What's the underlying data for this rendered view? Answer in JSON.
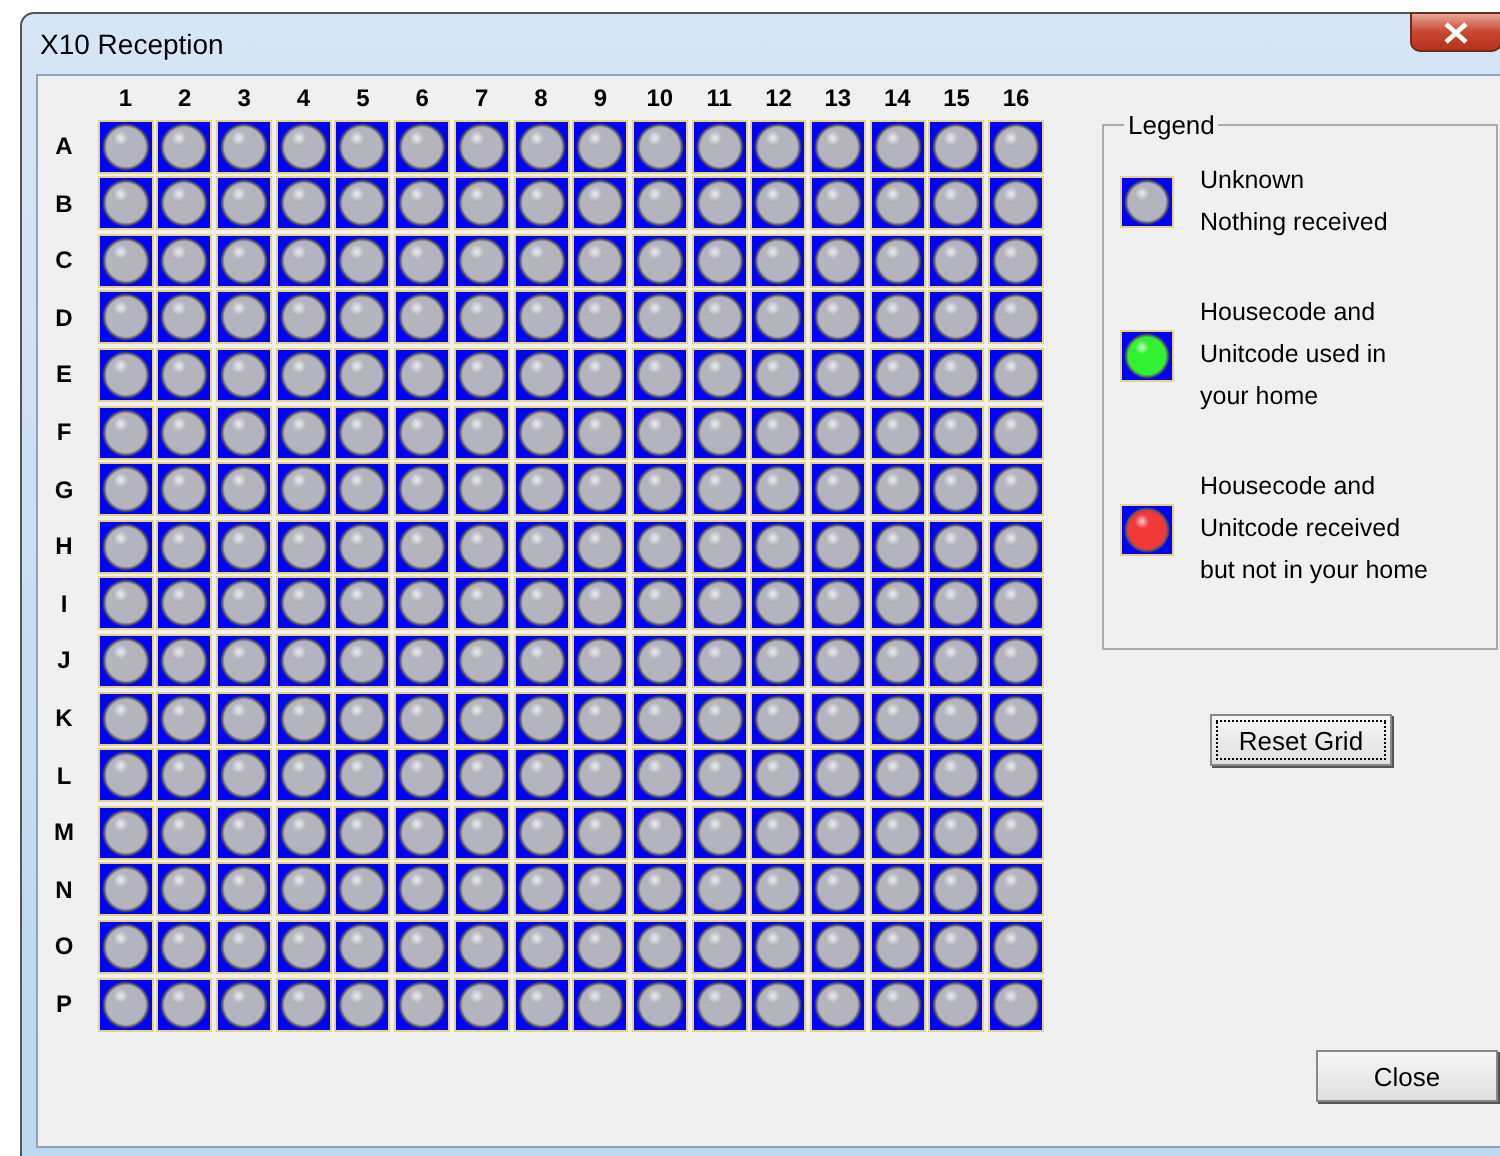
{
  "window": {
    "title": "X10 Reception"
  },
  "grid": {
    "columns": [
      "1",
      "2",
      "3",
      "4",
      "5",
      "6",
      "7",
      "8",
      "9",
      "10",
      "11",
      "12",
      "13",
      "14",
      "15",
      "16"
    ],
    "rows": [
      {
        "label": "A",
        "cells": [
          {
            "kind": "unknown"
          },
          {
            "kind": "unknown"
          },
          {
            "kind": "unknown"
          },
          {
            "kind": "unknown"
          },
          {
            "kind": "unknown"
          },
          {
            "kind": "unknown"
          },
          {
            "kind": "unknown"
          },
          {
            "kind": "unknown"
          },
          {
            "kind": "unknown"
          },
          {
            "kind": "unknown"
          },
          {
            "kind": "unknown"
          },
          {
            "kind": "unknown"
          },
          {
            "kind": "unknown"
          },
          {
            "kind": "unknown"
          },
          {
            "kind": "unknown"
          },
          {
            "kind": "unknown"
          }
        ]
      },
      {
        "label": "B",
        "cells": [
          {
            "kind": "unknown"
          },
          {
            "kind": "unknown"
          },
          {
            "kind": "unknown"
          },
          {
            "kind": "unknown"
          },
          {
            "kind": "unknown"
          },
          {
            "kind": "unknown"
          },
          {
            "kind": "unknown"
          },
          {
            "kind": "unknown"
          },
          {
            "kind": "unknown"
          },
          {
            "kind": "unknown"
          },
          {
            "kind": "unknown"
          },
          {
            "kind": "unknown"
          },
          {
            "kind": "unknown"
          },
          {
            "kind": "unknown"
          },
          {
            "kind": "unknown"
          },
          {
            "kind": "unknown"
          }
        ]
      },
      {
        "label": "C",
        "cells": [
          {
            "kind": "unknown"
          },
          {
            "kind": "unknown"
          },
          {
            "kind": "unknown"
          },
          {
            "kind": "unknown"
          },
          {
            "kind": "unknown"
          },
          {
            "kind": "unknown"
          },
          {
            "kind": "unknown"
          },
          {
            "kind": "unknown"
          },
          {
            "kind": "unknown"
          },
          {
            "kind": "unknown"
          },
          {
            "kind": "unknown"
          },
          {
            "kind": "unknown"
          },
          {
            "kind": "unknown"
          },
          {
            "kind": "unknown"
          },
          {
            "kind": "unknown"
          },
          {
            "kind": "unknown"
          }
        ]
      },
      {
        "label": "D",
        "cells": [
          {
            "kind": "unknown"
          },
          {
            "kind": "unknown"
          },
          {
            "kind": "unknown"
          },
          {
            "kind": "unknown"
          },
          {
            "kind": "unknown"
          },
          {
            "kind": "unknown"
          },
          {
            "kind": "unknown"
          },
          {
            "kind": "unknown"
          },
          {
            "kind": "unknown"
          },
          {
            "kind": "unknown"
          },
          {
            "kind": "unknown"
          },
          {
            "kind": "unknown"
          },
          {
            "kind": "unknown"
          },
          {
            "kind": "unknown"
          },
          {
            "kind": "unknown"
          },
          {
            "kind": "unknown"
          }
        ]
      },
      {
        "label": "E",
        "cells": [
          {
            "kind": "unknown"
          },
          {
            "kind": "unknown"
          },
          {
            "kind": "unknown"
          },
          {
            "kind": "unknown"
          },
          {
            "kind": "unknown"
          },
          {
            "kind": "unknown"
          },
          {
            "kind": "unknown"
          },
          {
            "kind": "unknown"
          },
          {
            "kind": "unknown"
          },
          {
            "kind": "unknown"
          },
          {
            "kind": "unknown"
          },
          {
            "kind": "unknown"
          },
          {
            "kind": "unknown"
          },
          {
            "kind": "unknown"
          },
          {
            "kind": "unknown"
          },
          {
            "kind": "unknown"
          }
        ]
      },
      {
        "label": "F",
        "cells": [
          {
            "kind": "unknown"
          },
          {
            "kind": "unknown"
          },
          {
            "kind": "unknown"
          },
          {
            "kind": "unknown"
          },
          {
            "kind": "unknown"
          },
          {
            "kind": "unknown"
          },
          {
            "kind": "unknown"
          },
          {
            "kind": "unknown"
          },
          {
            "kind": "unknown"
          },
          {
            "kind": "unknown"
          },
          {
            "kind": "unknown"
          },
          {
            "kind": "unknown"
          },
          {
            "kind": "unknown"
          },
          {
            "kind": "unknown"
          },
          {
            "kind": "unknown"
          },
          {
            "kind": "unknown"
          }
        ]
      },
      {
        "label": "G",
        "cells": [
          {
            "kind": "unknown"
          },
          {
            "kind": "unknown"
          },
          {
            "kind": "unknown"
          },
          {
            "kind": "unknown"
          },
          {
            "kind": "unknown"
          },
          {
            "kind": "unknown"
          },
          {
            "kind": "unknown"
          },
          {
            "kind": "unknown"
          },
          {
            "kind": "unknown"
          },
          {
            "kind": "unknown"
          },
          {
            "kind": "unknown"
          },
          {
            "kind": "unknown"
          },
          {
            "kind": "unknown"
          },
          {
            "kind": "unknown"
          },
          {
            "kind": "unknown"
          },
          {
            "kind": "unknown"
          }
        ]
      },
      {
        "label": "H",
        "cells": [
          {
            "kind": "unknown"
          },
          {
            "kind": "unknown"
          },
          {
            "kind": "unknown"
          },
          {
            "kind": "unknown"
          },
          {
            "kind": "unknown"
          },
          {
            "kind": "unknown"
          },
          {
            "kind": "unknown"
          },
          {
            "kind": "unknown"
          },
          {
            "kind": "unknown"
          },
          {
            "kind": "unknown"
          },
          {
            "kind": "unknown"
          },
          {
            "kind": "unknown"
          },
          {
            "kind": "unknown"
          },
          {
            "kind": "unknown"
          },
          {
            "kind": "unknown"
          },
          {
            "kind": "unknown"
          }
        ]
      },
      {
        "label": "I",
        "cells": [
          {
            "kind": "unknown"
          },
          {
            "kind": "unknown"
          },
          {
            "kind": "unknown"
          },
          {
            "kind": "unknown"
          },
          {
            "kind": "unknown"
          },
          {
            "kind": "unknown"
          },
          {
            "kind": "unknown"
          },
          {
            "kind": "unknown"
          },
          {
            "kind": "unknown"
          },
          {
            "kind": "unknown"
          },
          {
            "kind": "unknown"
          },
          {
            "kind": "unknown"
          },
          {
            "kind": "unknown"
          },
          {
            "kind": "unknown"
          },
          {
            "kind": "unknown"
          },
          {
            "kind": "unknown"
          }
        ]
      },
      {
        "label": "J",
        "cells": [
          {
            "kind": "unknown"
          },
          {
            "kind": "unknown"
          },
          {
            "kind": "unknown"
          },
          {
            "kind": "unknown"
          },
          {
            "kind": "unknown"
          },
          {
            "kind": "unknown"
          },
          {
            "kind": "unknown"
          },
          {
            "kind": "unknown"
          },
          {
            "kind": "unknown"
          },
          {
            "kind": "unknown"
          },
          {
            "kind": "unknown"
          },
          {
            "kind": "unknown"
          },
          {
            "kind": "unknown"
          },
          {
            "kind": "unknown"
          },
          {
            "kind": "unknown"
          },
          {
            "kind": "unknown"
          }
        ]
      },
      {
        "label": "K",
        "cells": [
          {
            "kind": "unknown"
          },
          {
            "kind": "unknown"
          },
          {
            "kind": "unknown"
          },
          {
            "kind": "unknown"
          },
          {
            "kind": "unknown"
          },
          {
            "kind": "unknown"
          },
          {
            "kind": "unknown"
          },
          {
            "kind": "unknown"
          },
          {
            "kind": "unknown"
          },
          {
            "kind": "unknown"
          },
          {
            "kind": "unknown"
          },
          {
            "kind": "unknown"
          },
          {
            "kind": "unknown"
          },
          {
            "kind": "unknown"
          },
          {
            "kind": "unknown"
          },
          {
            "kind": "unknown"
          }
        ]
      },
      {
        "label": "L",
        "cells": [
          {
            "kind": "unknown"
          },
          {
            "kind": "unknown"
          },
          {
            "kind": "unknown"
          },
          {
            "kind": "unknown"
          },
          {
            "kind": "unknown"
          },
          {
            "kind": "unknown"
          },
          {
            "kind": "unknown"
          },
          {
            "kind": "unknown"
          },
          {
            "kind": "unknown"
          },
          {
            "kind": "unknown"
          },
          {
            "kind": "unknown"
          },
          {
            "kind": "unknown"
          },
          {
            "kind": "unknown"
          },
          {
            "kind": "unknown"
          },
          {
            "kind": "unknown"
          },
          {
            "kind": "unknown"
          }
        ]
      },
      {
        "label": "M",
        "cells": [
          {
            "kind": "unknown"
          },
          {
            "kind": "unknown"
          },
          {
            "kind": "unknown"
          },
          {
            "kind": "unknown"
          },
          {
            "kind": "unknown"
          },
          {
            "kind": "unknown"
          },
          {
            "kind": "unknown"
          },
          {
            "kind": "unknown"
          },
          {
            "kind": "unknown"
          },
          {
            "kind": "unknown"
          },
          {
            "kind": "unknown"
          },
          {
            "kind": "unknown"
          },
          {
            "kind": "unknown"
          },
          {
            "kind": "unknown"
          },
          {
            "kind": "unknown"
          },
          {
            "kind": "unknown"
          }
        ]
      },
      {
        "label": "N",
        "cells": [
          {
            "kind": "unknown"
          },
          {
            "kind": "unknown"
          },
          {
            "kind": "unknown"
          },
          {
            "kind": "unknown"
          },
          {
            "kind": "unknown"
          },
          {
            "kind": "unknown"
          },
          {
            "kind": "unknown"
          },
          {
            "kind": "unknown"
          },
          {
            "kind": "unknown"
          },
          {
            "kind": "unknown"
          },
          {
            "kind": "unknown"
          },
          {
            "kind": "unknown"
          },
          {
            "kind": "unknown"
          },
          {
            "kind": "unknown"
          },
          {
            "kind": "unknown"
          },
          {
            "kind": "unknown"
          }
        ]
      },
      {
        "label": "O",
        "cells": [
          {
            "kind": "unknown"
          },
          {
            "kind": "unknown"
          },
          {
            "kind": "unknown"
          },
          {
            "kind": "unknown"
          },
          {
            "kind": "unknown"
          },
          {
            "kind": "unknown"
          },
          {
            "kind": "unknown"
          },
          {
            "kind": "unknown"
          },
          {
            "kind": "unknown"
          },
          {
            "kind": "unknown"
          },
          {
            "kind": "unknown"
          },
          {
            "kind": "unknown"
          },
          {
            "kind": "unknown"
          },
          {
            "kind": "unknown"
          },
          {
            "kind": "unknown"
          },
          {
            "kind": "unknown"
          }
        ]
      },
      {
        "label": "P",
        "cells": [
          {
            "kind": "unknown"
          },
          {
            "kind": "unknown"
          },
          {
            "kind": "unknown"
          },
          {
            "kind": "unknown"
          },
          {
            "kind": "unknown"
          },
          {
            "kind": "unknown"
          },
          {
            "kind": "unknown"
          },
          {
            "kind": "unknown"
          },
          {
            "kind": "unknown"
          },
          {
            "kind": "unknown"
          },
          {
            "kind": "unknown"
          },
          {
            "kind": "unknown"
          },
          {
            "kind": "unknown"
          },
          {
            "kind": "unknown"
          },
          {
            "kind": "unknown"
          },
          {
            "kind": "unknown"
          }
        ]
      }
    ]
  },
  "legend": {
    "title": "Legend",
    "items": [
      {
        "kind": "unknown",
        "text": "Unknown\nNothing received"
      },
      {
        "kind": "used",
        "text": "Housecode and\nUnitcode used in\nyour home"
      },
      {
        "kind": "foreign",
        "text": "Housecode and\nUnitcode received\nbut not in your home"
      }
    ]
  },
  "buttons": {
    "reset": "Reset Grid",
    "close": "Close"
  }
}
